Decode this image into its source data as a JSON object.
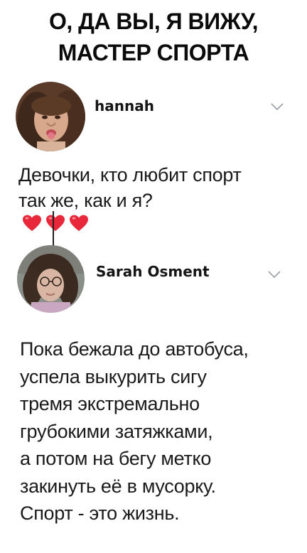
{
  "meme": {
    "title_lines": [
      "О, ДА ВЫ, Я ВИЖУ,",
      "МАСТЕР СПОРТА"
    ]
  },
  "post": {
    "username": "hannah",
    "text_line1": "Девочки, кто любит спорт",
    "text_line2": "так же, как и я?",
    "emoji": "❤️❤️❤️",
    "heart_color": "#e8283a"
  },
  "reply": {
    "username": "Sarah Osment",
    "text_lines": [
      "Пока бежала до автобуса,",
      "успела выкурить сигу",
      "тремя экстремально",
      "грубокими затяжками,",
      "а потом на бегу метко",
      "закинуть её в мусорку.",
      "Спорт - это жизнь."
    ]
  },
  "icons": {
    "dropdown": "chevron-down-icon"
  }
}
